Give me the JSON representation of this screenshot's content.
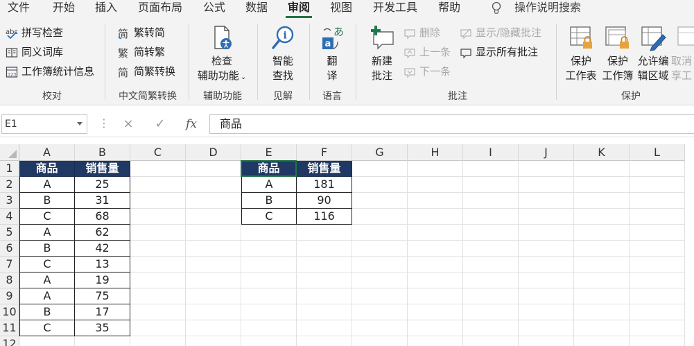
{
  "menu": {
    "tabs": [
      {
        "label": "文件",
        "active": false
      },
      {
        "label": "开始",
        "active": false
      },
      {
        "label": "插入",
        "active": false
      },
      {
        "label": "页面布局",
        "active": false
      },
      {
        "label": "公式",
        "active": false
      },
      {
        "label": "数据",
        "active": false
      },
      {
        "label": "审阅",
        "active": true
      },
      {
        "label": "视图",
        "active": false
      },
      {
        "label": "开发工具",
        "active": false
      },
      {
        "label": "帮助",
        "active": false
      }
    ],
    "tell_me": "操作说明搜索"
  },
  "ribbon": {
    "proofing": {
      "label": "校对",
      "spelling": "拼写检查",
      "thesaurus": "同义词库",
      "workbook_stats": "工作簿统计信息"
    },
    "chinese_conversion": {
      "label": "中文简繁转换",
      "to_traditional": "繁转简",
      "to_simplified": "简转繁",
      "convert": "简繁转换"
    },
    "accessibility": {
      "label": "辅助功能",
      "check_line1": "检查",
      "check_line2": "辅助功能"
    },
    "insights": {
      "label": "见解",
      "smart_line1": "智能",
      "smart_line2": "查找"
    },
    "language": {
      "label": "语言",
      "translate_line1": "翻",
      "translate_line2": "译"
    },
    "comments": {
      "label": "批注",
      "new_line1": "新建",
      "new_line2": "批注",
      "delete": "删除",
      "previous": "上一条",
      "next": "下一条",
      "show_hide": "显示/隐藏批注",
      "show_all": "显示所有批注"
    },
    "protect": {
      "label": "保护",
      "sheet_line1": "保护",
      "sheet_line2": "工作表",
      "workbook_line1": "保护",
      "workbook_line2": "工作簿",
      "edit_ranges_line1": "允许编",
      "edit_ranges_line2": "辑区域",
      "unshare_line1": "取消",
      "unshare_line2": "享工"
    }
  },
  "formula_bar": {
    "name_box": "E1",
    "cancel_icon": "×",
    "enter_icon": "✓",
    "fx": "fx",
    "content": "商品"
  },
  "sheet": {
    "columns": [
      "A",
      "B",
      "C",
      "D",
      "E",
      "F",
      "G",
      "H",
      "I",
      "J",
      "K",
      "L"
    ],
    "rows": [
      "1",
      "2",
      "3",
      "4",
      "5",
      "6",
      "7",
      "8",
      "9",
      "10",
      "11",
      "12"
    ],
    "table1": {
      "headers": [
        "商品",
        "销售量"
      ],
      "rows": [
        [
          "A",
          "25"
        ],
        [
          "B",
          "31"
        ],
        [
          "C",
          "68"
        ],
        [
          "A",
          "62"
        ],
        [
          "B",
          "42"
        ],
        [
          "C",
          "13"
        ],
        [
          "A",
          "19"
        ],
        [
          "A",
          "75"
        ],
        [
          "B",
          "17"
        ],
        [
          "C",
          "35"
        ]
      ]
    },
    "table2": {
      "headers": [
        "商品",
        "销售量"
      ],
      "rows": [
        [
          "A",
          "181"
        ],
        [
          "B",
          "90"
        ],
        [
          "C",
          "116"
        ]
      ]
    }
  },
  "colors": {
    "header_fill": "#203864",
    "accent": "#217346"
  }
}
